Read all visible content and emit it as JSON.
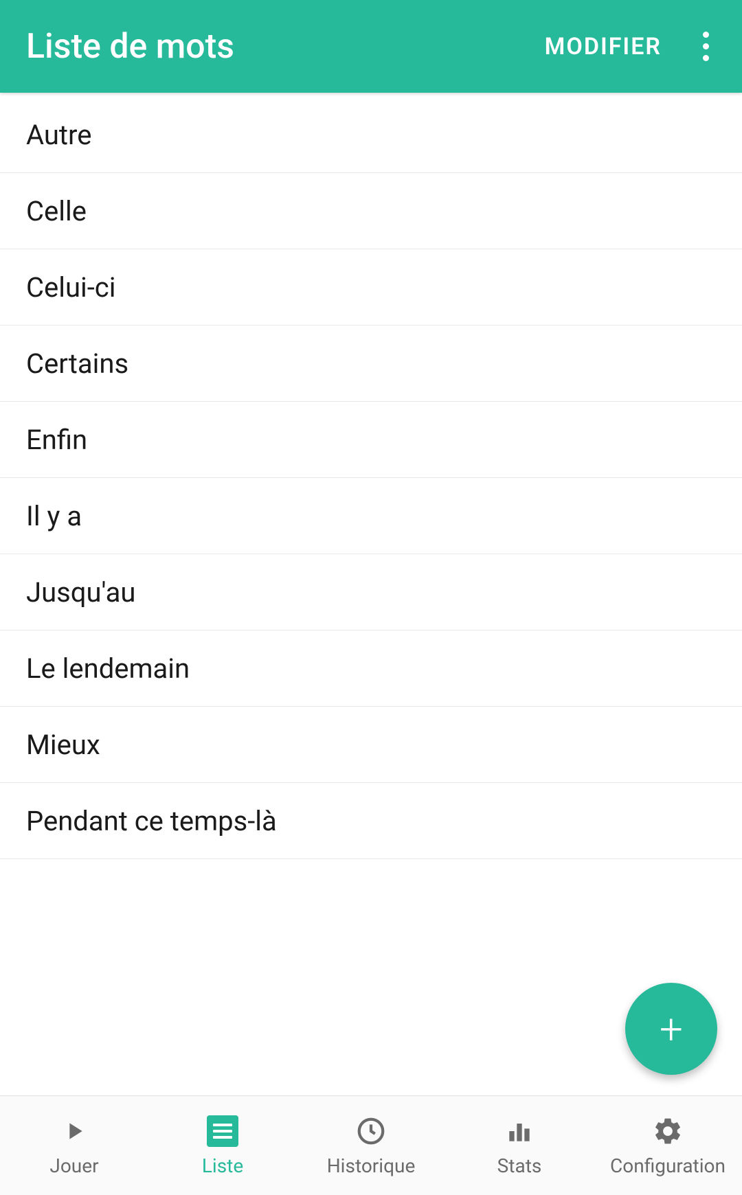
{
  "header": {
    "title": "Liste de mots",
    "modifier_label": "MODIFIER"
  },
  "words": [
    "Autre",
    "Celle",
    "Celui-ci",
    "Certains",
    "Enfin",
    "Il y a",
    "Jusqu'au",
    "Le lendemain",
    "Mieux",
    "Pendant ce temps-là"
  ],
  "nav": {
    "items": [
      {
        "label": "Jouer",
        "icon": "play-icon"
      },
      {
        "label": "Liste",
        "icon": "list-icon"
      },
      {
        "label": "Historique",
        "icon": "clock-icon"
      },
      {
        "label": "Stats",
        "icon": "stats-icon"
      },
      {
        "label": "Configuration",
        "icon": "gear-icon"
      }
    ],
    "active_index": 1
  },
  "fab": {
    "label": "+"
  }
}
